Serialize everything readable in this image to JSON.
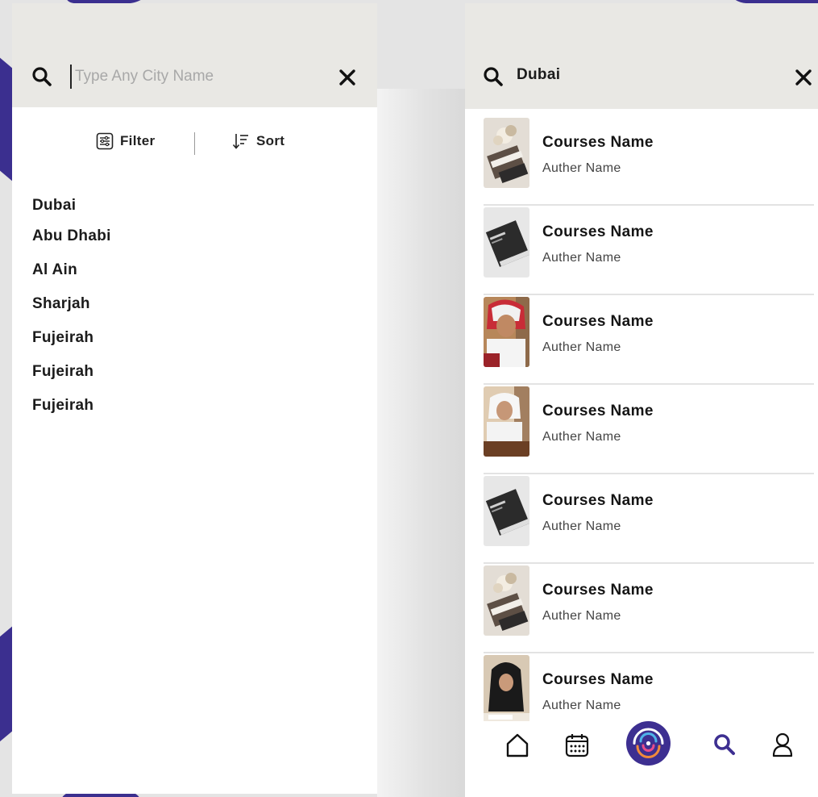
{
  "left_screen": {
    "search": {
      "placeholder": "Type Any City Name",
      "value": ""
    },
    "toolbar": {
      "filter_label": "Filter",
      "sort_label": "Sort"
    },
    "cities": [
      "Dubai",
      "Abu Dhabi",
      "Al Ain",
      "Sharjah",
      "Fujeirah",
      "Fujeirah",
      "Fujeirah"
    ]
  },
  "right_screen": {
    "search": {
      "value": "Dubai"
    },
    "results": [
      {
        "title": "Courses Name",
        "author": "Auther Name",
        "thumb": "books-flowers"
      },
      {
        "title": "Courses Name",
        "author": "Auther Name",
        "thumb": "dark-book"
      },
      {
        "title": "Courses Name",
        "author": "Auther Name",
        "thumb": "student-red-ghutra"
      },
      {
        "title": "Courses Name",
        "author": "Auther Name",
        "thumb": "student-white"
      },
      {
        "title": "Courses Name",
        "author": "Auther Name",
        "thumb": "dark-book"
      },
      {
        "title": "Courses Name",
        "author": "Auther Name",
        "thumb": "books-flowers"
      },
      {
        "title": "Courses Name",
        "author": "Auther Name",
        "thumb": "student-hijab"
      }
    ],
    "bottom_nav": {
      "items": [
        "home-icon",
        "calendar-icon",
        "app-logo-icon",
        "search-icon",
        "profile-icon"
      ],
      "active": "search-icon"
    }
  },
  "colors": {
    "accent": "#3d2f91",
    "search_bar_bg": "#e9e8e4",
    "text": "#151515"
  }
}
